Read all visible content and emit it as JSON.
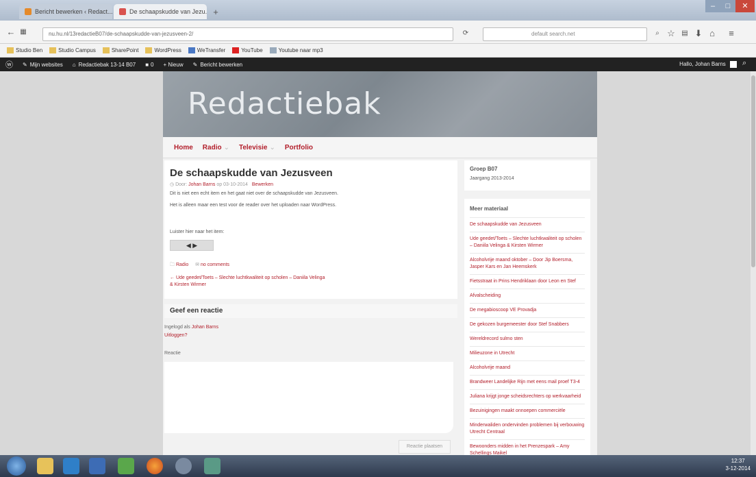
{
  "browser": {
    "tabs": [
      {
        "label": "Bericht bewerken ‹ Redact...",
        "active": false
      },
      {
        "label": "De schaapskudde van Jezu...",
        "active": true
      }
    ],
    "new_tab": "+",
    "window_controls": {
      "minimize": "–",
      "maximize": "□",
      "close": "✕"
    },
    "url": "nu.hu.nl/13redactieB07/de-schaapskudde-van-jezusveen-2/",
    "search_placeholder": "default search.net",
    "bookmarks": [
      "Studio Ben",
      "Studio Campus",
      "SharePoint",
      "WordPress",
      "WeTransfer",
      "YouTube",
      "Youtube naar mp3"
    ]
  },
  "adminbar": {
    "items": [
      "Mijn websites",
      "Redactiebak 13-14 B07",
      "0",
      "+ Nieuw",
      "Bericht bewerken"
    ],
    "greeting": "Hallo, Johan Barns"
  },
  "site": {
    "title": "Redactiebak",
    "menu": [
      {
        "label": "Home",
        "dropdown": false
      },
      {
        "label": "Radio",
        "dropdown": true
      },
      {
        "label": "Televisie",
        "dropdown": true
      },
      {
        "label": "Portfolio",
        "dropdown": false
      }
    ]
  },
  "post": {
    "title": "De schaapskudde van Jezusveen",
    "meta_prefix": "Door: ",
    "author": "Johan Barns",
    "date": "op 03-10-2014",
    "edit": "Bewerken",
    "p1": "Dit is niet een echt item en het gaat niet over de schaapskudde van Jezusveen.",
    "p2": "Het is alleen maar een test voor de reader over het uploaden naar WordPress.",
    "listen": "Luister hier naar het item:",
    "player": "◀  ▶",
    "category": "Radio",
    "comments": "no comments",
    "prev_post": "← Ude geedet/Toets – Slechte luchtkwaliteit op scholen – Daniila Velinga & Kirsten Wirmer"
  },
  "reply": {
    "heading": "Geef een reactie",
    "logged_in_prefix": "Ingelogd als ",
    "logged_in_user": "Johan Barns",
    "logout": "Uitloggen?",
    "field_label": "Reactie",
    "submit": "Reactie plaatsen"
  },
  "sidebar": {
    "widget1_title": "Groep B07",
    "widget1_text": "Jaargang 2013-2014",
    "widget2_title": "Meer materiaal",
    "links": [
      "De schaapskudde van Jezusveen",
      "Ude geedet/Toets – Slechte luchtkwaliteit op scholen – Daniila Velinga & Kirsten Wirmer",
      "Alcoholvrije maand oktober – Door Jip Boersma, Jasper Kars en Jan Heemskerk",
      "Fietsstraat in Prins Hendriklaan door Leon en Stef",
      "Afvalscheiding",
      "De megabioscoop VE Provadja",
      "De gekozen burgemeester door Stef Snabbers",
      "Wereldrecord sulmo sten",
      "Milieuzone in Utrecht",
      "Alcoholvrije maand",
      "Brandweer Landelijke Rijn met eens mail proef T3-4",
      "Juliana krijgt jonge scheidsrechters op werkvaarheid",
      "Bezuinigingen maakt onnoepen commerciële",
      "Minderwaliden ondervinden problemen bij verbouwing Utrecht Centraal",
      "Bewoonders midden in het Prenzespark – Amy Schellings Maikel"
    ]
  },
  "taskbar": {
    "time": "12:37",
    "date": "3-12-2014"
  },
  "colors": {
    "accent": "#b21e2a",
    "adminbar": "#222222",
    "taskbar": "#3a475c"
  }
}
